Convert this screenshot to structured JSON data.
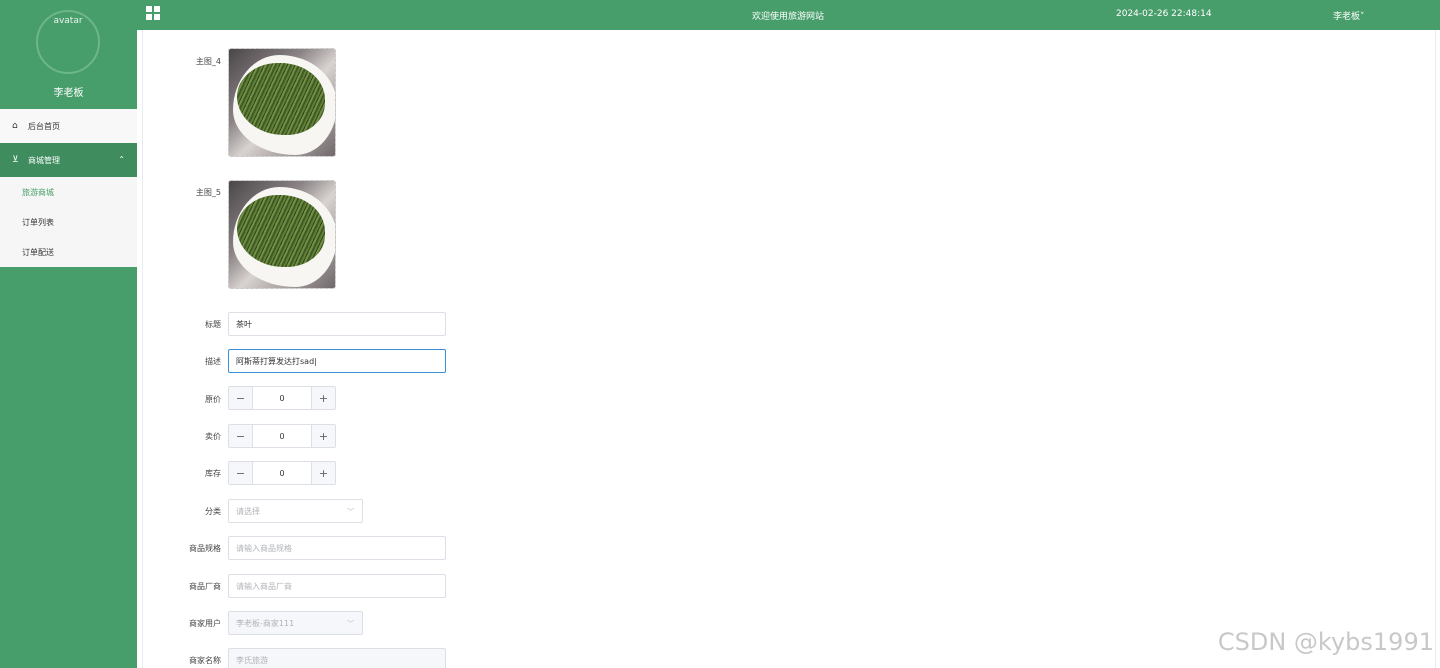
{
  "sidebar": {
    "avatar_text": "avatar",
    "username": "李老板",
    "home": "后台首页",
    "group": "商城管理",
    "subitems": [
      "旅游商城",
      "订单列表",
      "订单配送"
    ]
  },
  "topbar": {
    "welcome": "欢迎使用旅游网站",
    "datetime": "2024-02-26 22:48:14",
    "user": "李老板"
  },
  "form": {
    "image4_label": "主图_4",
    "image5_label": "主图_5",
    "title_label": "标题",
    "title_value": "茶叶",
    "desc_label": "描述",
    "desc_value": "阿斯蒂打算发达打sad|",
    "orig_price_label": "原价",
    "orig_price_value": "0",
    "sale_price_label": "卖价",
    "sale_price_value": "0",
    "stock_label": "库存",
    "stock_value": "0",
    "category_label": "分类",
    "category_placeholder": "请选择",
    "spec_label": "商品规格",
    "spec_placeholder": "请输入商品规格",
    "maker_label": "商品厂商",
    "maker_placeholder": "请输入商品厂商",
    "merchant_label": "商家用户",
    "merchant_value": "李老板-商家111",
    "shop_label": "商家名称",
    "shop_placeholder": "李氏旅游",
    "minus": "−",
    "plus": "+"
  },
  "watermark": "CSDN @kybs1991"
}
